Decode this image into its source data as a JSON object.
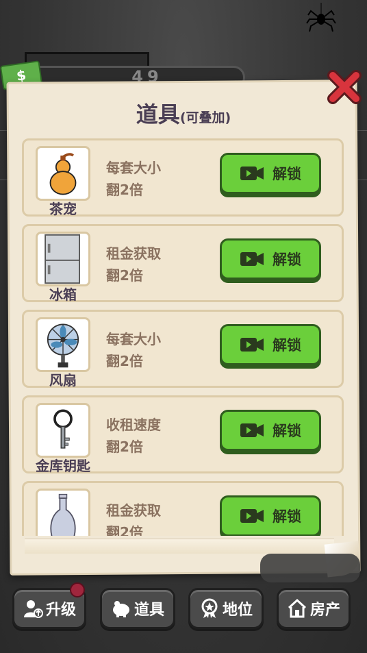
{
  "hud": {
    "money_value": "49"
  },
  "panel": {
    "title": "道具",
    "subtitle": "(可叠加)"
  },
  "items": [
    {
      "name": "茶宠",
      "desc_line1": "每套大小",
      "desc_line2": "翻2倍",
      "button": "解锁",
      "icon": "gourd-icon"
    },
    {
      "name": "冰箱",
      "desc_line1": "租金获取",
      "desc_line2": "翻2倍",
      "button": "解锁",
      "icon": "fridge-icon"
    },
    {
      "name": "风扇",
      "desc_line1": "每套大小",
      "desc_line2": "翻2倍",
      "button": "解锁",
      "icon": "fan-icon"
    },
    {
      "name": "金库钥匙",
      "desc_line1": "收租速度",
      "desc_line2": "翻2倍",
      "button": "解锁",
      "icon": "key-icon"
    },
    {
      "name": "",
      "desc_line1": "租金获取",
      "desc_line2": "翻2倍",
      "button": "解锁",
      "icon": "vase-icon"
    }
  ],
  "nav": [
    {
      "label": "升级",
      "icon": "upgrade-icon"
    },
    {
      "label": "道具",
      "icon": "piggy-icon"
    },
    {
      "label": "地位",
      "icon": "medal-icon"
    },
    {
      "label": "房产",
      "icon": "house-icon"
    }
  ],
  "colors": {
    "accent_green": "#6bcf3b",
    "paper": "#f1e8d6",
    "title_text": "#4a3e54",
    "close_red": "#d8343d"
  }
}
